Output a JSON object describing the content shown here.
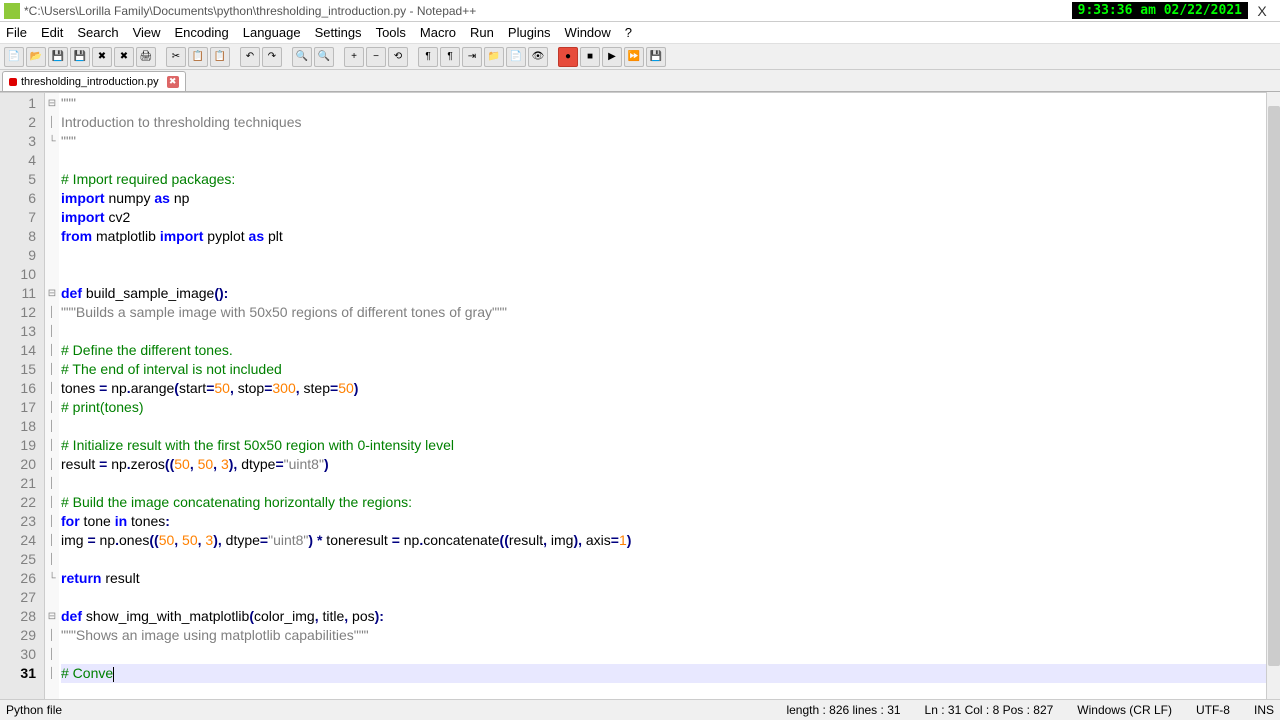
{
  "title": "*C:\\Users\\Lorilla Family\\Documents\\python\\thresholding_introduction.py - Notepad++",
  "clock": "9:33:36 am 02/22/2021",
  "menus": [
    "File",
    "Edit",
    "Search",
    "View",
    "Encoding",
    "Language",
    "Settings",
    "Tools",
    "Macro",
    "Run",
    "Plugins",
    "Window",
    "?"
  ],
  "tab": {
    "name": "thresholding_introduction.py"
  },
  "lines": [
    {
      "n": 1,
      "fold": "⊟",
      "html": "<span class='str'>\"\"\"</span>"
    },
    {
      "n": 2,
      "fold": "│",
      "html": "<span class='str'>Introduction to thresholding techniques</span>"
    },
    {
      "n": 3,
      "fold": "└",
      "html": "<span class='str'>\"\"\"</span>"
    },
    {
      "n": 4,
      "fold": "",
      "html": ""
    },
    {
      "n": 5,
      "fold": "",
      "html": "<span class='cmt'># Import required packages:</span>"
    },
    {
      "n": 6,
      "fold": "",
      "html": "<span class='kw'>import</span> numpy <span class='kw'>as</span> np"
    },
    {
      "n": 7,
      "fold": "",
      "html": "<span class='kw'>import</span> cv2"
    },
    {
      "n": 8,
      "fold": "",
      "html": "<span class='kw'>from</span> matplotlib <span class='kw'>import</span> pyplot <span class='kw'>as</span> plt"
    },
    {
      "n": 9,
      "fold": "",
      "html": ""
    },
    {
      "n": 10,
      "fold": "",
      "html": ""
    },
    {
      "n": 11,
      "fold": "⊟",
      "html": "<span class='kw'>def</span> <span class='fn'>build_sample_image</span><span class='op'>():</span>"
    },
    {
      "n": 12,
      "fold": "│",
      "html": "<span class='str'>\"\"\"Builds a sample image with 50x50 regions of different tones of gray\"\"\"</span>"
    },
    {
      "n": 13,
      "fold": "│",
      "html": ""
    },
    {
      "n": 14,
      "fold": "│",
      "html": "<span class='cmt'># Define the different tones.</span>"
    },
    {
      "n": 15,
      "fold": "│",
      "html": "<span class='cmt'># The end of interval is not included</span>"
    },
    {
      "n": 16,
      "fold": "│",
      "html": "tones <span class='op'>=</span> np<span class='op'>.</span>arange<span class='op'>(</span>start<span class='op'>=</span><span class='num'>50</span><span class='op'>,</span> stop<span class='op'>=</span><span class='num'>300</span><span class='op'>,</span> step<span class='op'>=</span><span class='num'>50</span><span class='op'>)</span>"
    },
    {
      "n": 17,
      "fold": "│",
      "html": "<span class='cmt'># print(tones)</span>"
    },
    {
      "n": 18,
      "fold": "│",
      "html": ""
    },
    {
      "n": 19,
      "fold": "│",
      "html": "<span class='cmt'># Initialize result with the first 50x50 region with 0-intensity level</span>"
    },
    {
      "n": 20,
      "fold": "│",
      "html": "result <span class='op'>=</span> np<span class='op'>.</span>zeros<span class='op'>((</span><span class='num'>50</span><span class='op'>,</span> <span class='num'>50</span><span class='op'>,</span> <span class='num'>3</span><span class='op'>),</span> dtype<span class='op'>=</span><span class='str'>\"uint8\"</span><span class='op'>)</span>"
    },
    {
      "n": 21,
      "fold": "│",
      "html": ""
    },
    {
      "n": 22,
      "fold": "│",
      "html": "<span class='cmt'># Build the image concatenating horizontally the regions:</span>"
    },
    {
      "n": 23,
      "fold": "│",
      "html": "<span class='kw'>for</span> tone <span class='kw'>in</span> tones<span class='op'>:</span>"
    },
    {
      "n": 24,
      "fold": "│",
      "html": "img <span class='op'>=</span> np<span class='op'>.</span>ones<span class='op'>((</span><span class='num'>50</span><span class='op'>,</span> <span class='num'>50</span><span class='op'>,</span> <span class='num'>3</span><span class='op'>),</span> dtype<span class='op'>=</span><span class='str'>\"uint8\"</span><span class='op'>)</span> <span class='op'>*</span> toneresult <span class='op'>=</span> np<span class='op'>.</span>concatenate<span class='op'>((</span>result<span class='op'>,</span> img<span class='op'>),</span> axis<span class='op'>=</span><span class='num'>1</span><span class='op'>)</span>"
    },
    {
      "n": 25,
      "fold": "│",
      "html": ""
    },
    {
      "n": 26,
      "fold": "└",
      "html": "<span class='kw'>return</span> result"
    },
    {
      "n": 27,
      "fold": "",
      "html": ""
    },
    {
      "n": 28,
      "fold": "⊟",
      "html": "<span class='kw'>def</span> <span class='fn'>show_img_with_matplotlib</span><span class='op'>(</span>color_img<span class='op'>,</span> title<span class='op'>,</span> pos<span class='op'>):</span>"
    },
    {
      "n": 29,
      "fold": "│",
      "html": "<span class='str'>\"\"\"Shows an image using matplotlib capabilities\"\"\"</span>"
    },
    {
      "n": 30,
      "fold": "│",
      "html": ""
    },
    {
      "n": 31,
      "fold": "│",
      "cur": true,
      "html": "<span class='cmt'># Conve</span><span class='caret'></span>"
    }
  ],
  "status": {
    "lang": "Python file",
    "len": "length : 826    lines : 31",
    "pos": "Ln : 31    Col : 8    Pos : 827",
    "eol": "Windows (CR LF)",
    "enc": "UTF-8",
    "mode": "INS"
  }
}
